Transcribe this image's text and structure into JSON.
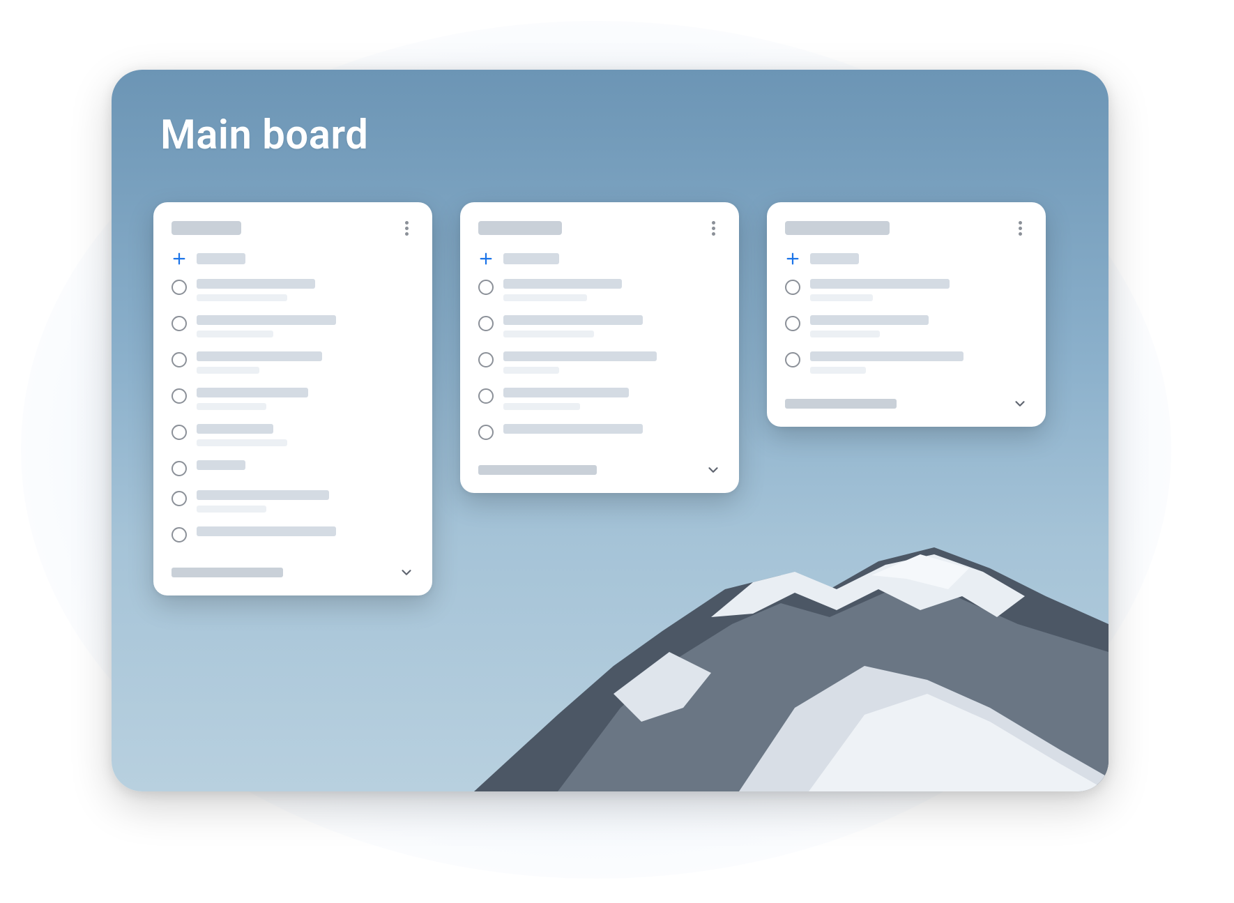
{
  "board": {
    "title": "Main board",
    "columns": [
      {
        "title_placeholder_width": 100,
        "add_placeholder_width": 70,
        "tasks": [
          {
            "lines": [
              170,
              130
            ]
          },
          {
            "lines": [
              200,
              110
            ]
          },
          {
            "lines": [
              180,
              90
            ]
          },
          {
            "lines": [
              160,
              100
            ]
          },
          {
            "lines": [
              110,
              130
            ]
          },
          {
            "lines": [
              70,
              0
            ]
          },
          {
            "lines": [
              190,
              100
            ]
          },
          {
            "lines": [
              200,
              0
            ]
          }
        ],
        "footer_placeholder_width": 160
      },
      {
        "title_placeholder_width": 120,
        "add_placeholder_width": 80,
        "tasks": [
          {
            "lines": [
              170,
              120
            ]
          },
          {
            "lines": [
              200,
              130
            ]
          },
          {
            "lines": [
              220,
              80
            ]
          },
          {
            "lines": [
              180,
              110
            ]
          },
          {
            "lines": [
              200,
              0
            ]
          }
        ],
        "footer_placeholder_width": 170
      },
      {
        "title_placeholder_width": 150,
        "add_placeholder_width": 70,
        "tasks": [
          {
            "lines": [
              200,
              90
            ]
          },
          {
            "lines": [
              170,
              100
            ]
          },
          {
            "lines": [
              220,
              80
            ]
          }
        ],
        "footer_placeholder_width": 160
      }
    ]
  },
  "colors": {
    "accent": "#1a73e8",
    "placeholder": "#d4dbe3",
    "placeholder_strong": "#c9d0d8",
    "placeholder_sub": "#ecf0f4"
  }
}
